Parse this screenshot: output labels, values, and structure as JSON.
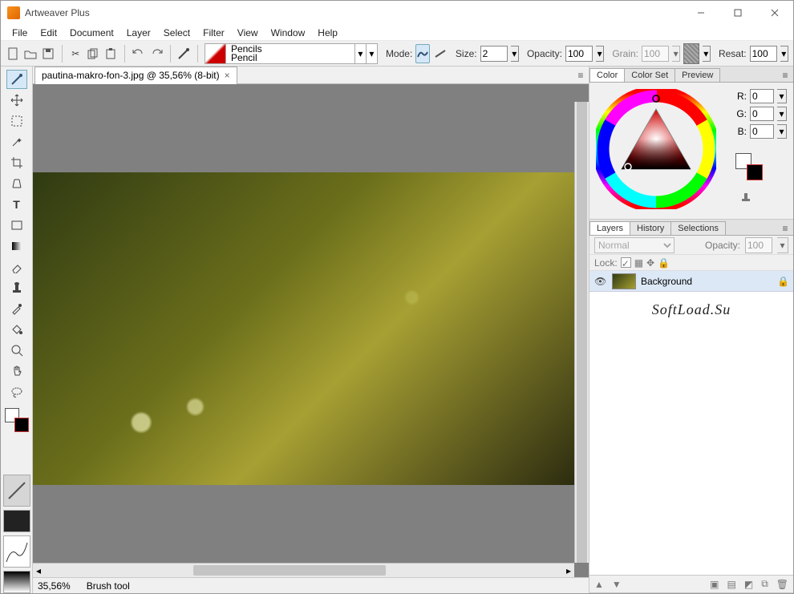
{
  "app": {
    "title": "Artweaver Plus"
  },
  "menu": {
    "items": [
      "File",
      "Edit",
      "Document",
      "Layer",
      "Select",
      "Filter",
      "View",
      "Window",
      "Help"
    ]
  },
  "optionbar": {
    "brush_category": "Pencils",
    "brush_variant": "Pencil",
    "mode_label": "Mode:",
    "size_label": "Size:",
    "size_value": "2",
    "opacity_label": "Opacity:",
    "opacity_value": "100",
    "grain_label": "Grain:",
    "grain_value": "100",
    "resat_label": "Resat:",
    "resat_value": "100"
  },
  "document": {
    "tab_title": "pautina-makro-fon-3.jpg @ 35,56% (8-bit)",
    "zoom": "35,56%",
    "status_tool": "Brush tool"
  },
  "color_panel": {
    "tabs": [
      "Color",
      "Color Set",
      "Preview"
    ],
    "r_label": "R:",
    "r_value": "0",
    "g_label": "G:",
    "g_value": "0",
    "b_label": "B:",
    "b_value": "0"
  },
  "layers_panel": {
    "tabs": [
      "Layers",
      "History",
      "Selections"
    ],
    "blend_mode": "Normal",
    "opacity_label": "Opacity:",
    "opacity_value": "100",
    "lock_label": "Lock:",
    "layer_name": "Background"
  },
  "watermark": "SoftLoad.Su"
}
